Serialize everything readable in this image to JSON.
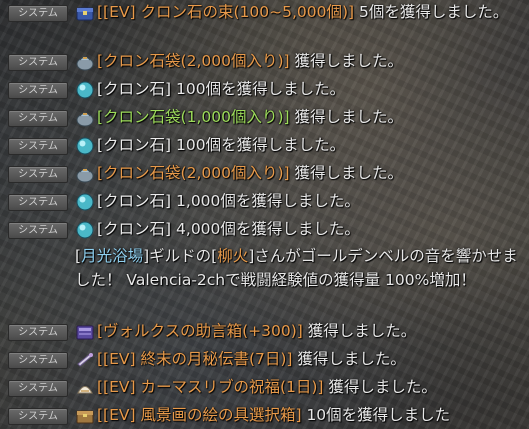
{
  "colors": {
    "orange_item": "#e89a4a",
    "green_item": "#9ddc5a",
    "blue_item": "#8fd0f0",
    "badge_bg": "#5a5a5a"
  },
  "messages": [
    {
      "badge": "システム",
      "icon": "chest-icon",
      "name": "[[EV] クロン石の束(100~5,000個)]",
      "rest": " 5個を獲得しました。",
      "name_color": "orange"
    },
    {
      "badge": "システム",
      "icon": "pouch-icon",
      "name": "[クロン石袋(2,000個入り)]",
      "rest": " 獲得しました。",
      "name_color": "orange"
    },
    {
      "badge": "システム",
      "icon": "crystal-icon",
      "name": "[クロン石]",
      "rest": " 100個を獲得しました。",
      "name_color": "white"
    },
    {
      "badge": "システム",
      "icon": "pouch-icon",
      "name": "[クロン石袋(1,000個入り)]",
      "rest": " 獲得しました。",
      "name_color": "green"
    },
    {
      "badge": "システム",
      "icon": "crystal-icon",
      "name": "[クロン石]",
      "rest": " 100個を獲得しました。",
      "name_color": "white"
    },
    {
      "badge": "システム",
      "icon": "pouch-icon",
      "name": "[クロン石袋(2,000個入り)]",
      "rest": " 獲得しました。",
      "name_color": "orange"
    },
    {
      "badge": "システム",
      "icon": "crystal-icon",
      "name": "[クロン石]",
      "rest": " 1,000個を獲得しました。",
      "name_color": "white"
    },
    {
      "badge": "システム",
      "icon": "crystal-icon",
      "name": "[クロン石]",
      "rest": " 4,000個を獲得しました。",
      "name_color": "white"
    }
  ],
  "guild_message": {
    "open": "[",
    "guild": "月光浴場",
    "mid1": "]ギルドの[",
    "player": "柳火",
    "mid2": "]さんがゴールデンベルの音を響かせました！ Valencia-2chで戦闘経験値の獲得量 100%増加！"
  },
  "messages2": [
    {
      "badge": "システム",
      "icon": "book-box-icon",
      "name": "[ヴォルクスの助言箱(+300)]",
      "rest": " 獲得しました。",
      "name_color": "orange"
    },
    {
      "badge": "システム",
      "icon": "scroll-icon",
      "name": "[[EV] 終末の月秘伝書(7日)]",
      "rest": " 獲得しました。",
      "name_color": "orange"
    },
    {
      "badge": "システム",
      "icon": "blessing-icon",
      "name": "[[EV] カーマスリブの祝福(1日)]",
      "rest": " 獲得しました。",
      "name_color": "orange"
    },
    {
      "badge": "システム",
      "icon": "paint-box-icon",
      "name": "[[EV] 風景画の絵の具選択箱]",
      "rest": " 10個を獲得しました",
      "name_color": "orange"
    }
  ]
}
